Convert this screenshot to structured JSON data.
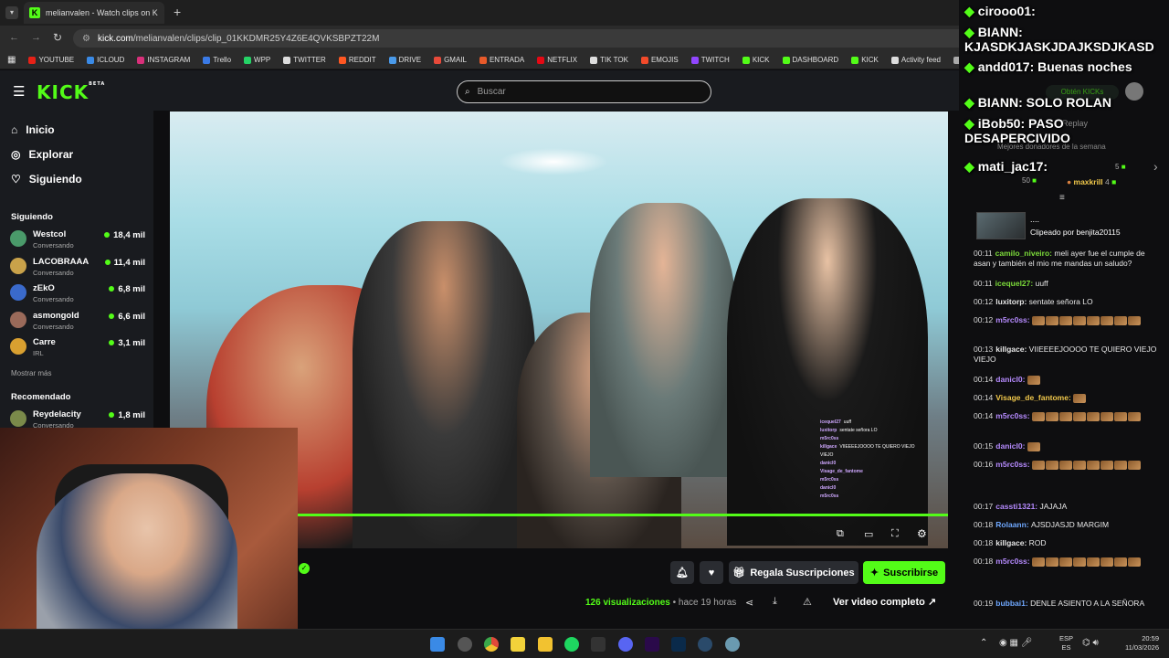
{
  "browser": {
    "tab_title": "melianvalen - Watch clips on K",
    "url_host": "kick.com",
    "url_path": "/melianvalen/clips/clip_01KKDMR25Y4Z6E4QVKSBPZT22M",
    "bookmarks": [
      "YOUTUBE",
      "ICLOUD",
      "INSTAGRAM",
      "Trello",
      "WPP",
      "TWITTER",
      "REDDIT",
      "DRIVE",
      "GMAIL",
      "ENTRADA",
      "NETFLIX",
      "TIK TOK",
      "EMOJIS",
      "TWITCH",
      "KICK",
      "DASHBOARD",
      "KICK",
      "Activity feed",
      "ANTISCU"
    ],
    "colors": {
      "kick_green": "#53fc18",
      "bg": "#0e0e10",
      "panel": "#191b1f"
    }
  },
  "site": {
    "logo": "KICK",
    "logo_badge": "BETA",
    "search_placeholder": "Buscar"
  },
  "sidebar": {
    "nav": [
      {
        "label": "Inicio",
        "icon": "home-icon"
      },
      {
        "label": "Explorar",
        "icon": "compass-icon"
      },
      {
        "label": "Siguiendo",
        "icon": "heart-icon"
      }
    ],
    "following_title": "Siguiendo",
    "following": [
      {
        "name": "Westcol",
        "category": "Conversando",
        "viewers": "18,4 mil",
        "color": "#4a9a6a"
      },
      {
        "name": "LACOBRAAA",
        "category": "Conversando",
        "viewers": "11,4 mil",
        "color": "#c9a24a"
      },
      {
        "name": "zEkO",
        "category": "Conversando",
        "viewers": "6,8 mil",
        "color": "#3a6acb"
      },
      {
        "name": "asmongold",
        "category": "Conversando",
        "viewers": "6,6 mil",
        "color": "#9a6a5a"
      },
      {
        "name": "Carre",
        "category": "IRL",
        "viewers": "3,1 mil",
        "color": "#d9a030"
      }
    ],
    "show_more": "Mostrar más",
    "recommended_title": "Recomendado",
    "recommended": [
      {
        "name": "Reydelacity",
        "category": "Conversando",
        "viewers": "1,8 mil",
        "color": "#7a8a4a"
      }
    ]
  },
  "clip": {
    "views_count": "126",
    "views_label": "visualizaciones",
    "time": "hace 19 horas",
    "gift_label": "Regala Suscripciones",
    "subscribe_label": "Suscribirse",
    "full_video_label": "Ver video completo",
    "progress": 1.0
  },
  "video_chat": [
    {
      "user": "icequel27",
      "text": "uuff"
    },
    {
      "user": "luxitorp",
      "text": "sentate señora LO"
    },
    {
      "user": "m5rc0ss",
      "text": ""
    },
    {
      "user": "killgace",
      "text": "VIIEEEEJOOOO TE QUIERO VIEJO"
    },
    {
      "user": "",
      "text": "VIEJO"
    },
    {
      "user": "danicl0",
      "text": ""
    },
    {
      "user": "Visage_de_fantome",
      "text": ""
    },
    {
      "user": "m5rc0ss",
      "text": ""
    },
    {
      "user": "danicl0",
      "text": ""
    },
    {
      "user": "m5rc0ss",
      "text": ""
    }
  ],
  "overlay": {
    "lines": [
      {
        "user": "cirooo01:",
        "text": ""
      },
      {
        "user": "BIANN:",
        "text": "KJASDKJASKJDAJKSDJKASD"
      },
      {
        "user": "andd017:",
        "text": "Buenas noches"
      },
      {
        "user": "BIANN:",
        "text": "SOLO ROLAN"
      },
      {
        "user": "iBob50:",
        "text": "PASO DESAPERCIVIDO"
      },
      {
        "user": "mati_jac17:",
        "text": ""
      }
    ],
    "behind_kicks": "Obtén KICKs",
    "behind_replay": "Replay",
    "behind_donors": "Mejores donadores de la semana",
    "donor_name": "maxkrill",
    "donor_count": "4",
    "donor_left_count": "50",
    "donor_right_count": "5"
  },
  "chat": {
    "clip_author": "Clipeado por benjita20115",
    "clip_dots": "....",
    "messages": [
      {
        "time": "00:11",
        "user": "camilo_niveiro",
        "color": "#7cdb3a",
        "text": "meli ayer fue el cumple de asan y también el mio me mandas un saludo?"
      },
      {
        "time": "00:11",
        "user": "icequel27",
        "color": "#7cdb3a",
        "text": "uuff"
      },
      {
        "time": "00:12",
        "user": "luxitorp",
        "color": "#e8e8e8",
        "text": "sentate señora LO"
      },
      {
        "time": "00:12",
        "user": "m5rc0ss",
        "color": "#b68bff",
        "text": ""
      },
      {
        "time": "00:13",
        "user": "killgace",
        "color": "#e8e8e8",
        "text": "VIIEEEEJOOOO TE QUIERO VIEJO VIEJO"
      },
      {
        "time": "00:14",
        "user": "danicl0",
        "color": "#b68bff",
        "text": ""
      },
      {
        "time": "00:14",
        "user": "Visage_de_fantome",
        "color": "#f2c94c",
        "text": ""
      },
      {
        "time": "00:14",
        "user": "m5rc0ss",
        "color": "#b68bff",
        "text": ""
      },
      {
        "time": "00:15",
        "user": "danicl0",
        "color": "#b68bff",
        "text": ""
      },
      {
        "time": "00:16",
        "user": "m5rc0ss",
        "color": "#b68bff",
        "text": ""
      },
      {
        "time": "00:17",
        "user": "cassti1321",
        "color": "#b68bff",
        "text": "JAJAJA"
      },
      {
        "time": "00:18",
        "user": "Rolaann",
        "color": "#6fa8ff",
        "text": "AJSDJASJD MARGIM"
      },
      {
        "time": "00:18",
        "user": "killgace",
        "color": "#e8e8e8",
        "text": "ROD"
      },
      {
        "time": "00:18",
        "user": "m5rc0ss",
        "color": "#b68bff",
        "text": ""
      },
      {
        "time": "00:19",
        "user": "bubbai1",
        "color": "#6fa8ff",
        "text": "DENLE ASIENTO A LA SEÑORA"
      }
    ]
  },
  "taskbar": {
    "lang_top": "ESP",
    "lang_bottom": "ES",
    "time": "20:59",
    "date": "11/03/2026"
  }
}
